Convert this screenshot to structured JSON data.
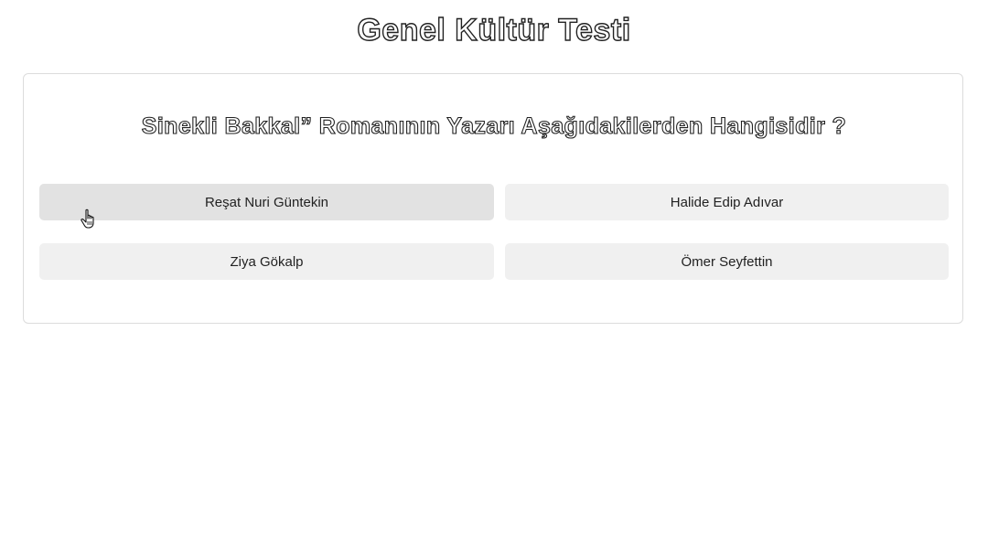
{
  "page": {
    "title": "Genel Kültür Testi"
  },
  "quiz": {
    "question": "Sinekli Bakkal” Romanının Yazarı Aşağıdakilerden Hangisidir ?",
    "answers": [
      {
        "label": "Reşat Nuri Güntekin",
        "hovered": true
      },
      {
        "label": "Halide Edip Adıvar",
        "hovered": false
      },
      {
        "label": "Ziya Gökalp",
        "hovered": false
      },
      {
        "label": "Ömer Seyfettin",
        "hovered": false
      }
    ]
  },
  "colors": {
    "answer_bg": "#f0f0f0",
    "answer_hover_bg": "#e2e2e2",
    "card_border": "#dcdcdc",
    "text": "#222222"
  },
  "icons": {
    "cursor": "hand-pointer-icon"
  }
}
